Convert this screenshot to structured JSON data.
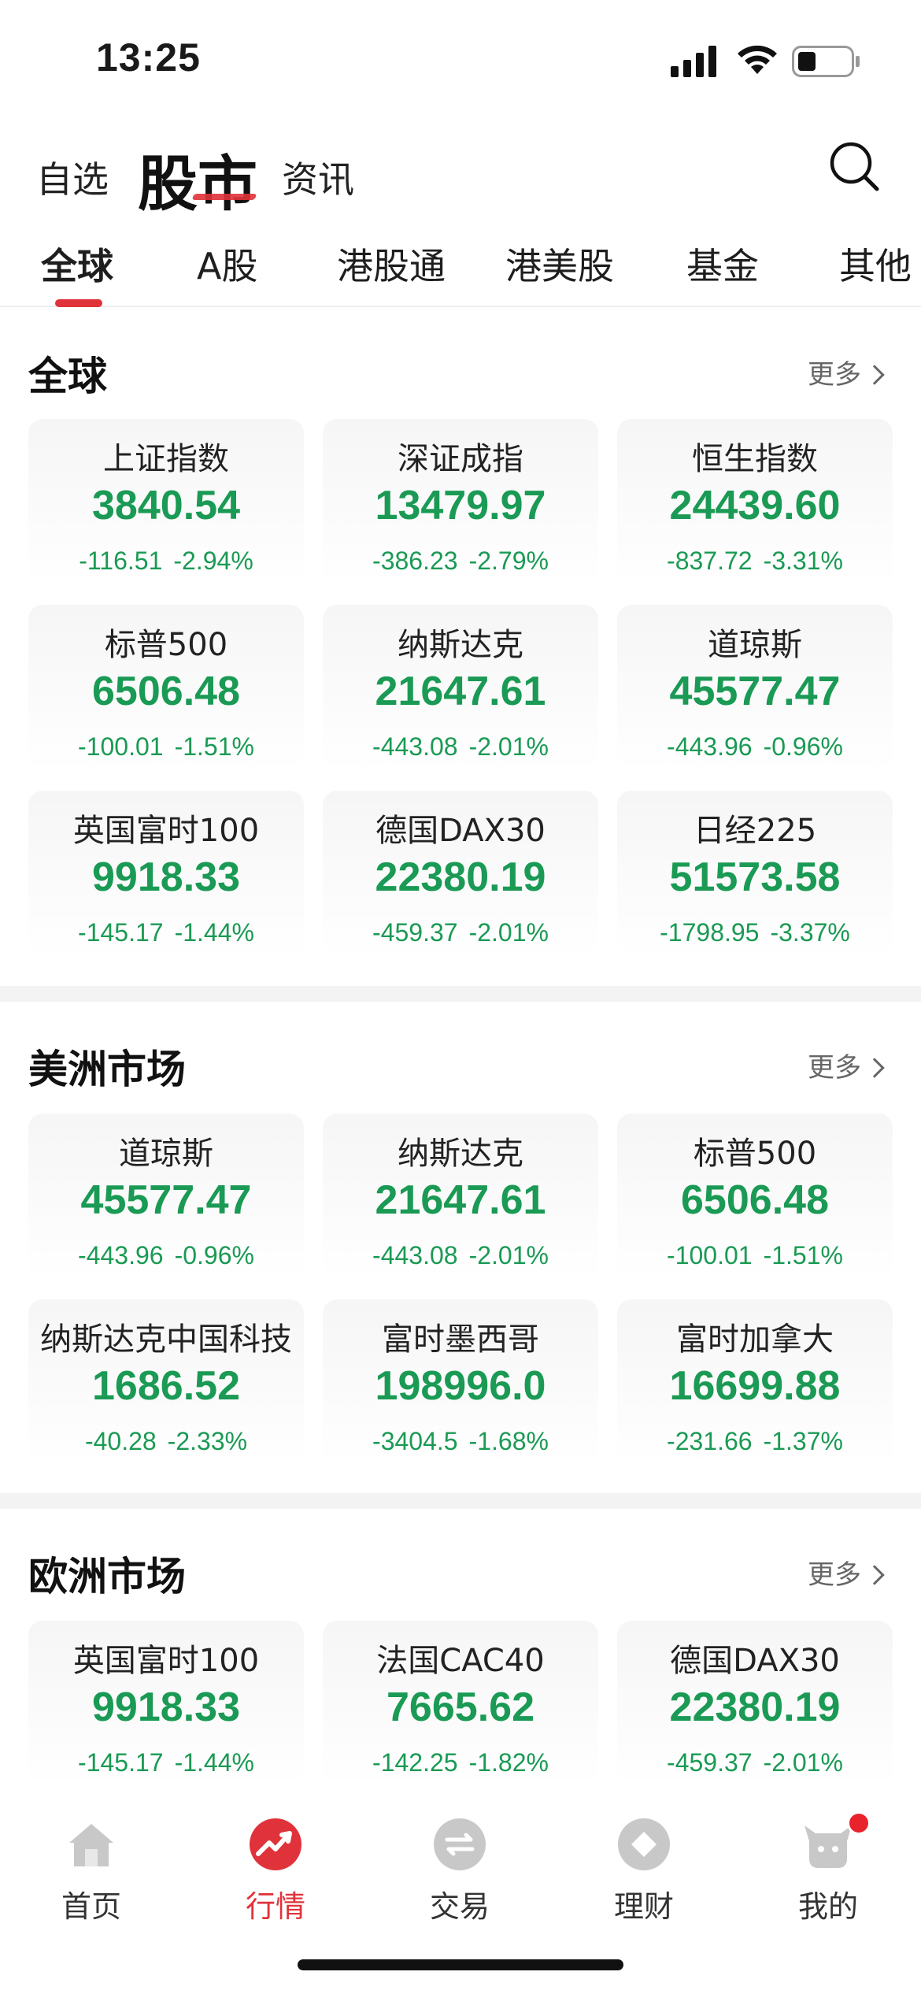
{
  "status": {
    "time": "13:25"
  },
  "top_nav": {
    "tab_zixuan": "自选",
    "tab_gushi": "股市",
    "tab_zixun": "资讯"
  },
  "sub_tabs": [
    "全球",
    "A股",
    "港股通",
    "港美股",
    "基金",
    "其他"
  ],
  "colors": {
    "down": "#1a9a54",
    "accent": "#e0323a"
  },
  "sections": [
    {
      "title": "全球",
      "more": "更多",
      "cards": [
        {
          "name": "上证指数",
          "price": "3840.54",
          "change": "-116.51",
          "pct": "-2.94%"
        },
        {
          "name": "深证成指",
          "price": "13479.97",
          "change": "-386.23",
          "pct": "-2.79%"
        },
        {
          "name": "恒生指数",
          "price": "24439.60",
          "change": "-837.72",
          "pct": "-3.31%"
        },
        {
          "name": "标普500",
          "price": "6506.48",
          "change": "-100.01",
          "pct": "-1.51%"
        },
        {
          "name": "纳斯达克",
          "price": "21647.61",
          "change": "-443.08",
          "pct": "-2.01%"
        },
        {
          "name": "道琼斯",
          "price": "45577.47",
          "change": "-443.96",
          "pct": "-0.96%"
        },
        {
          "name": "英国富时100",
          "price": "9918.33",
          "change": "-145.17",
          "pct": "-1.44%"
        },
        {
          "name": "德国DAX30",
          "price": "22380.19",
          "change": "-459.37",
          "pct": "-2.01%"
        },
        {
          "name": "日经225",
          "price": "51573.58",
          "change": "-1798.95",
          "pct": "-3.37%"
        }
      ]
    },
    {
      "title": "美洲市场",
      "more": "更多",
      "cards": [
        {
          "name": "道琼斯",
          "price": "45577.47",
          "change": "-443.96",
          "pct": "-0.96%"
        },
        {
          "name": "纳斯达克",
          "price": "21647.61",
          "change": "-443.08",
          "pct": "-2.01%"
        },
        {
          "name": "标普500",
          "price": "6506.48",
          "change": "-100.01",
          "pct": "-1.51%"
        },
        {
          "name": "纳斯达克中国科技",
          "price": "1686.52",
          "change": "-40.28",
          "pct": "-2.33%"
        },
        {
          "name": "富时墨西哥",
          "price": "198996.0",
          "change": "-3404.5",
          "pct": "-1.68%"
        },
        {
          "name": "富时加拿大",
          "price": "16699.88",
          "change": "-231.66",
          "pct": "-1.37%"
        }
      ]
    },
    {
      "title": "欧洲市场",
      "more": "更多",
      "cards": [
        {
          "name": "英国富时100",
          "price": "9918.33",
          "change": "-145.17",
          "pct": "-1.44%"
        },
        {
          "name": "法国CAC40",
          "price": "7665.62",
          "change": "-142.25",
          "pct": "-1.82%"
        },
        {
          "name": "德国DAX30",
          "price": "22380.19",
          "change": "-459.37",
          "pct": "-2.01%"
        }
      ]
    }
  ],
  "bottom_nav": [
    {
      "label": "首页",
      "icon": "home-icon"
    },
    {
      "label": "行情",
      "icon": "market-trend-icon"
    },
    {
      "label": "交易",
      "icon": "trade-exchange-icon"
    },
    {
      "label": "理财",
      "icon": "wealth-diamond-icon"
    },
    {
      "label": "我的",
      "icon": "profile-bull-icon"
    }
  ]
}
